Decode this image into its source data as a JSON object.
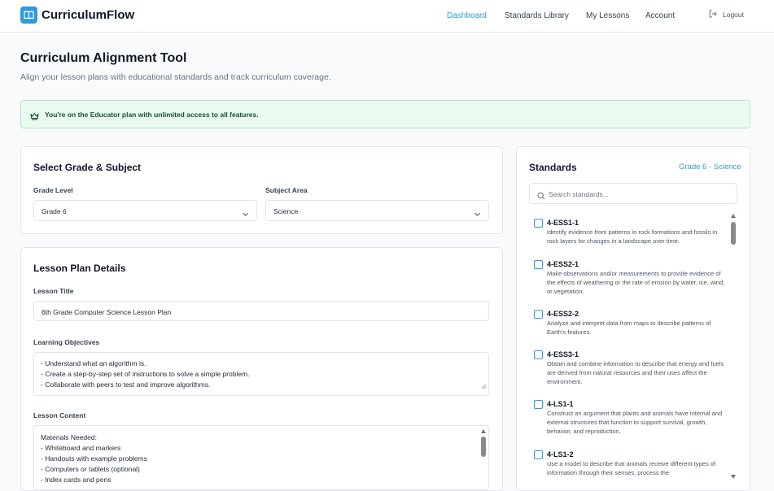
{
  "header": {
    "app_name": "CurriculumFlow",
    "nav": [
      {
        "label": "Dashboard",
        "active": true
      },
      {
        "label": "Standards Library",
        "active": false
      },
      {
        "label": "My Lessons",
        "active": false
      },
      {
        "label": "Account",
        "active": false
      }
    ],
    "logout_label": "Logout"
  },
  "page": {
    "title": "Curriculum Alignment Tool",
    "subtitle": "Align your lesson plans with educational standards and track curriculum coverage."
  },
  "banner": {
    "icon": "crown-icon",
    "text": "You're on the Educator plan with unlimited access to all features."
  },
  "grade_subject": {
    "title": "Select Grade & Subject",
    "grade_label": "Grade Level",
    "grade_value": "Grade 6",
    "subject_label": "Subject Area",
    "subject_value": "Science"
  },
  "lesson": {
    "title": "Lesson Plan Details",
    "title_label": "Lesson Title",
    "title_value": "6th Grade Computer Science Lesson Plan",
    "objectives_label": "Learning Objectives",
    "objectives": [
      "- Understand what an algorithm is.",
      "- Create a step-by-step set of instructions to solve a simple problem.",
      "- Collaborate with peers to test and improve algorithms."
    ],
    "content_label": "Lesson Content",
    "content": [
      "Materials Needed:",
      "- Whiteboard and markers",
      "- Handouts with example problems",
      "- Computers or tablets (optional)",
      "- Index cards and pens"
    ]
  },
  "standards": {
    "title": "Standards",
    "context": "Grade 6 - Science",
    "search_placeholder": "Search standards...",
    "items": [
      {
        "code": "4-ESS1-1",
        "description": "Identify evidence from patterns in rock formations and fossils in rock layers for changes in a landscape over time.",
        "checked": false
      },
      {
        "code": "4-ESS2-1",
        "description": "Make observations and/or measurements to provide evidence of the effects of weathering or the rate of erosion by water, ice, wind, or vegetation.",
        "checked": false
      },
      {
        "code": "4-ESS2-2",
        "description": "Analyze and interpret data from maps to describe patterns of Earth's features.",
        "checked": false
      },
      {
        "code": "4-ESS3-1",
        "description": "Obtain and combine information to describe that energy and fuels are derived from natural resources and their uses affect the environment.",
        "checked": false
      },
      {
        "code": "4-LS1-1",
        "description": "Construct an argument that plants and animals have internal and external structures that function to support survival, growth, behavior, and reproduction.",
        "checked": false
      },
      {
        "code": "4-LS1-2",
        "description": "Use a model to describe that animals receive different types of information through their senses, process the",
        "checked": false
      }
    ]
  },
  "colors": {
    "accent": "#2f9bdc",
    "banner_bg": "#eafaf1",
    "banner_text": "#14532d"
  }
}
